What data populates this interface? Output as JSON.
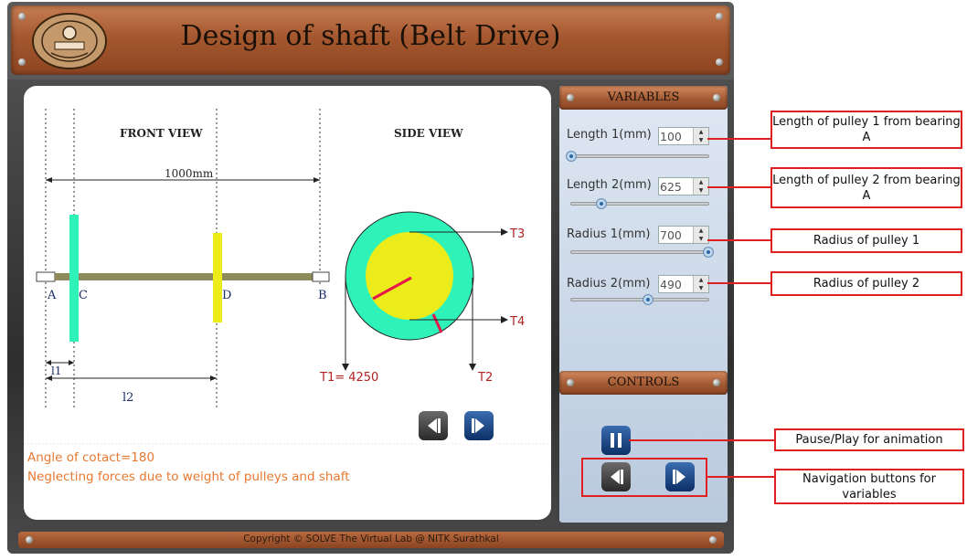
{
  "header": {
    "title": "Design of shaft (Belt Drive)"
  },
  "diagram": {
    "front_view_label": "FRONT VIEW",
    "side_view_label": "SIDE VIEW",
    "total_length_label": "1000mm",
    "point_a": "A",
    "point_c": "C",
    "point_d": "D",
    "point_b": "B",
    "l1_label": "l1",
    "l2_label": "l2",
    "t1_label": "T1= 4250",
    "t2_label": "T2",
    "t3_label": "T3",
    "t4_label": "T4",
    "colors": {
      "pulley1": "#2ef2b8",
      "pulley2": "#ecec1a",
      "shaft": "#8e8a5c",
      "belt_marker": "#e8174a",
      "label_red": "#b22222"
    }
  },
  "notes": {
    "line1": "Angle of cotact=180",
    "line2": "Neglecting forces due to weight of pulleys and shaft"
  },
  "variables_panel": {
    "title": "VARIABLES",
    "items": [
      {
        "label": "Length 1(mm)",
        "value": "100",
        "slider_fraction": 0.0
      },
      {
        "label": "Length 2(mm)",
        "value": "625",
        "slider_fraction": 0.22
      },
      {
        "label": "Radius 1(mm)",
        "value": "700",
        "slider_fraction": 1.0
      },
      {
        "label": "Radius 2(mm)",
        "value": "490",
        "slider_fraction": 0.56
      }
    ]
  },
  "controls_panel": {
    "title": "CONTROLS"
  },
  "footer": {
    "text": "Copyright © SOLVE The Virtual Lab @ NITK Surathkal"
  },
  "callouts": {
    "length1": "Length of pulley 1 from bearing A",
    "length2": "Length of pulley 2 from bearing A",
    "radius1": "Radius  of pulley 1",
    "radius2": "Radius  of pulley 2",
    "pause_play": "Pause/Play for animation",
    "navigation": "Navigation buttons for variables"
  }
}
